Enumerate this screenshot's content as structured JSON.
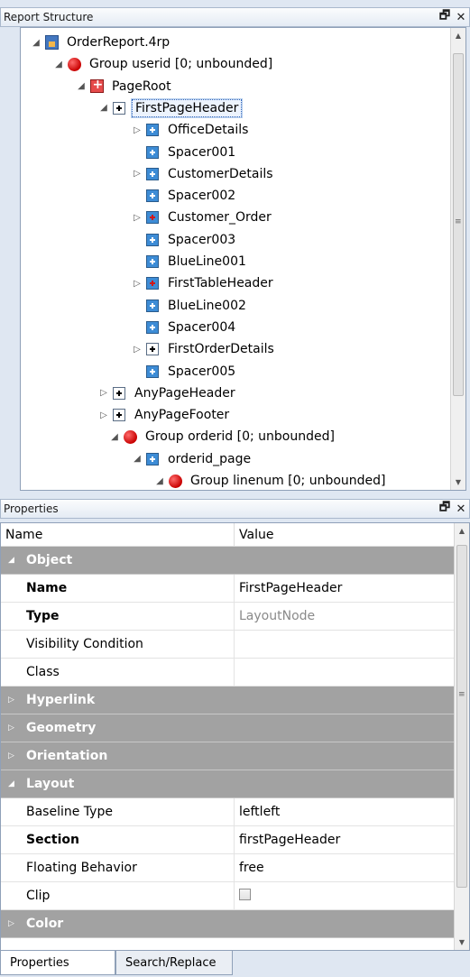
{
  "tree_panel": {
    "title": "Report Structure",
    "controls": {
      "float": "🗗",
      "close": "✕"
    },
    "scroll": {
      "up": "▲",
      "down": "▼",
      "grip": "≡"
    },
    "nodes": [
      {
        "label": "OrderReport.4rp",
        "arrow": "◢",
        "icon": "report-file-icon"
      },
      {
        "label": "Group userid [0; unbounded]",
        "arrow": "◢",
        "icon": "group-icon"
      },
      {
        "label": "PageRoot",
        "arrow": "◢",
        "icon": "page-root-icon"
      },
      {
        "label": "FirstPageHeader",
        "arrow": "◢",
        "icon": "layout-node-icon",
        "selected": true
      },
      {
        "label": "OfficeDetails",
        "arrow": "▷",
        "icon": "layout-node-blue-icon"
      },
      {
        "label": "Spacer001",
        "arrow": "",
        "icon": "layout-node-blue-icon"
      },
      {
        "label": "CustomerDetails",
        "arrow": "▷",
        "icon": "layout-node-blue-icon"
      },
      {
        "label": "Spacer002",
        "arrow": "",
        "icon": "layout-node-blue-icon"
      },
      {
        "label": "Customer_Order",
        "arrow": "▷",
        "icon": "layout-node-red-icon"
      },
      {
        "label": "Spacer003",
        "arrow": "",
        "icon": "layout-node-blue-icon"
      },
      {
        "label": "BlueLine001",
        "arrow": "",
        "icon": "layout-node-blue-icon"
      },
      {
        "label": "FirstTableHeader",
        "arrow": "▷",
        "icon": "layout-node-red-icon"
      },
      {
        "label": "BlueLine002",
        "arrow": "",
        "icon": "layout-node-blue-icon"
      },
      {
        "label": "Spacer004",
        "arrow": "",
        "icon": "layout-node-blue-icon"
      },
      {
        "label": "FirstOrderDetails",
        "arrow": "▷",
        "icon": "layout-node-icon"
      },
      {
        "label": "Spacer005",
        "arrow": "",
        "icon": "layout-node-blue-icon"
      },
      {
        "label": "AnyPageHeader",
        "arrow": "▷",
        "icon": "layout-node-icon"
      },
      {
        "label": "AnyPageFooter",
        "arrow": "▷",
        "icon": "layout-node-icon"
      },
      {
        "label": "Group orderid [0; unbounded]",
        "arrow": "◢",
        "icon": "group-icon"
      },
      {
        "label": "orderid_page",
        "arrow": "◢",
        "icon": "layout-node-blue-icon"
      },
      {
        "label": "Group linenum [0; unbounded]",
        "arrow": "◢",
        "icon": "group-icon"
      }
    ]
  },
  "properties_panel": {
    "title": "Properties",
    "controls": {
      "float": "🗗",
      "close": "✕"
    },
    "columns": {
      "name": "Name",
      "value": "Value"
    },
    "scroll": {
      "up": "▲",
      "down": "▼",
      "grip": "≡"
    },
    "categories": {
      "object": {
        "label": "Object",
        "tri": "◢"
      },
      "hyperlink": {
        "label": "Hyperlink",
        "tri": "▷"
      },
      "geometry": {
        "label": "Geometry",
        "tri": "▷"
      },
      "orientation": {
        "label": "Orientation",
        "tri": "▷"
      },
      "layout": {
        "label": "Layout",
        "tri": "◢"
      },
      "color": {
        "label": "Color",
        "tri": "▷"
      }
    },
    "object_rows": [
      {
        "name": "Name",
        "value": "FirstPageHeader",
        "bold": true
      },
      {
        "name": "Type",
        "value": "LayoutNode",
        "bold": true,
        "grey": true
      },
      {
        "name": "Visibility Condition",
        "value": ""
      },
      {
        "name": "Class",
        "value": ""
      }
    ],
    "layout_rows": [
      {
        "name": "Baseline Type",
        "value": "leftleft"
      },
      {
        "name": "Section",
        "value": "firstPageHeader",
        "bold": true
      },
      {
        "name": "Floating Behavior",
        "value": "free"
      },
      {
        "name": "Clip",
        "value": "",
        "checkbox": true
      }
    ]
  },
  "bottom_tabs": {
    "properties": "Properties",
    "search_replace": "Search/Replace"
  }
}
